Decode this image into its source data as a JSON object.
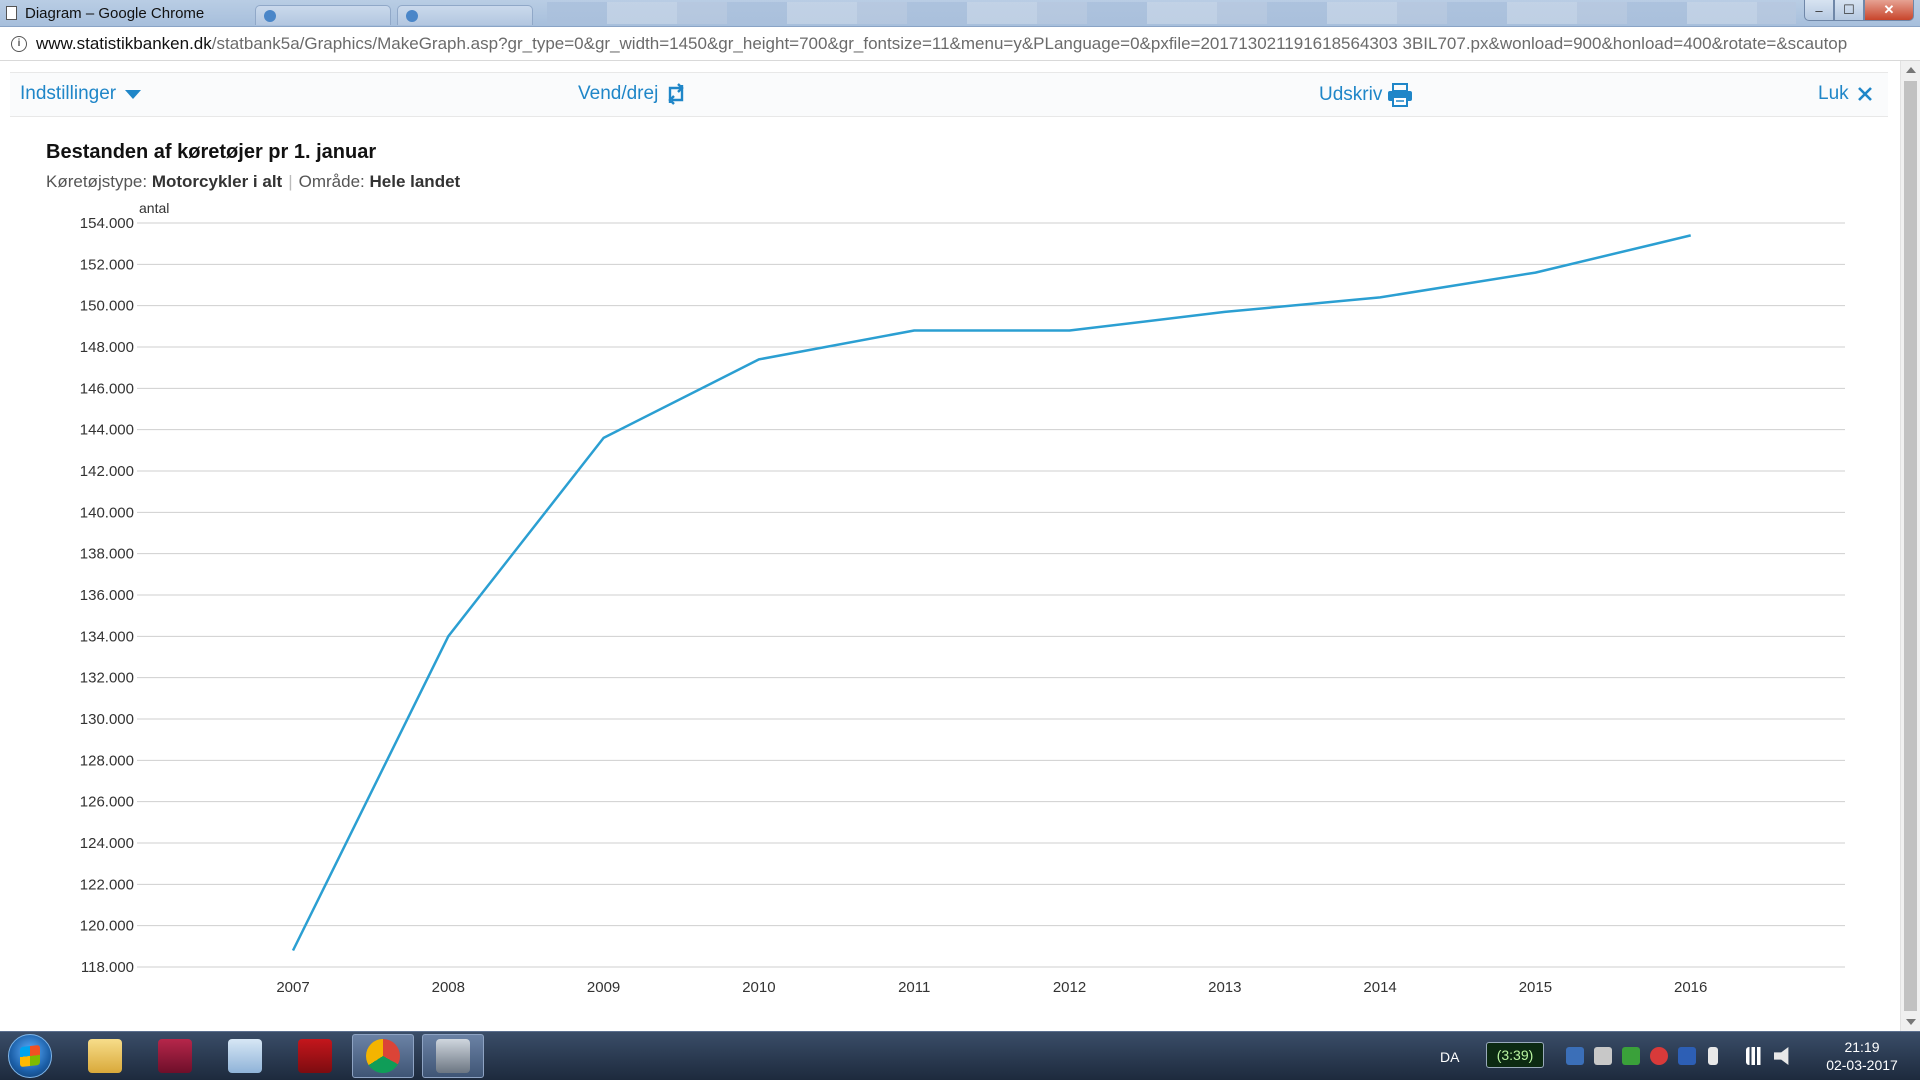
{
  "window": {
    "title": "Diagram – Google Chrome",
    "controls": {
      "minimize": "–",
      "maximize": "☐",
      "close": "✕"
    }
  },
  "address": {
    "host": "www.statistikbanken.dk",
    "path": "/statbank5a/Graphics/MakeGraph.asp?gr_type=0&gr_width=1450&gr_height=700&gr_fontsize=11&menu=y&PLanguage=0&pxfile=201713021191618564303 3BIL707.px&wonload=900&honload=400&rotate=&scautop"
  },
  "toolbar": {
    "settings_label": "Indstillinger",
    "rotate_label": "Vend/drej",
    "print_label": "Udskriv",
    "close_label": "Luk"
  },
  "chart_header": {
    "title": "Bestanden af køretøjer pr 1. januar",
    "vehicle_type_label": "Køretøjstype:",
    "vehicle_type_value": "Motorcykler i alt",
    "area_label": "Område:",
    "area_value": "Hele landet"
  },
  "chart_data": {
    "type": "line",
    "title": "Bestanden af køretøjer pr 1. januar",
    "ylabel": "antal",
    "xlabel": "",
    "categories": [
      "2007",
      "2008",
      "2009",
      "2010",
      "2011",
      "2012",
      "2013",
      "2014",
      "2015",
      "2016"
    ],
    "series": [
      {
        "name": "Motorcykler i alt",
        "values": [
          118800,
          134000,
          143600,
          147400,
          148800,
          148800,
          149700,
          150400,
          151600,
          153400
        ]
      }
    ],
    "ylim": [
      118000,
      154000
    ],
    "yticks": [
      118000,
      120000,
      122000,
      124000,
      126000,
      128000,
      130000,
      132000,
      134000,
      136000,
      138000,
      140000,
      142000,
      144000,
      146000,
      148000,
      150000,
      152000,
      154000
    ],
    "ytick_labels": [
      "118.000",
      "120.000",
      "122.000",
      "124.000",
      "126.000",
      "128.000",
      "130.000",
      "132.000",
      "134.000",
      "136.000",
      "138.000",
      "140.000",
      "142.000",
      "144.000",
      "146.000",
      "148.000",
      "150.000",
      "152.000",
      "154.000"
    ],
    "grid": "horizontal",
    "line_color": "#2b9fd2"
  },
  "taskbar": {
    "language": "DA",
    "battery": "(3:39)",
    "time": "21:19",
    "date": "02-03-2017"
  }
}
